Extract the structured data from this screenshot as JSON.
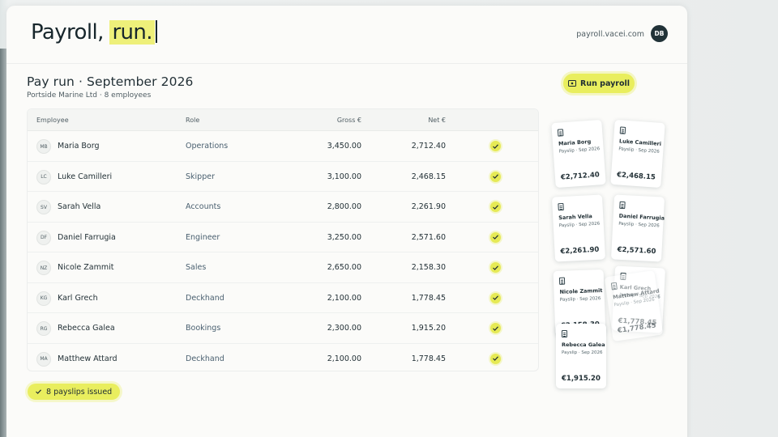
{
  "app": {
    "logo_main": "Payroll,",
    "logo_highlight": "run.",
    "domain": "payroll.vacei.com",
    "user_initials": "DB"
  },
  "header": {
    "title": "Pay run · September 2026",
    "subtitle": "Portside Marine Ltd · 8 employees",
    "run_button": "Run payroll"
  },
  "table": {
    "columns": [
      "Employee",
      "Role",
      "Gross €",
      "Net €"
    ],
    "rows": [
      {
        "initials": "MB",
        "name": "Maria Borg",
        "role": "Operations",
        "gross": "3,450.00",
        "net": "2,712.40"
      },
      {
        "initials": "LC",
        "name": "Luke Camilleri",
        "role": "Skipper",
        "gross": "3,100.00",
        "net": "2,468.15"
      },
      {
        "initials": "SV",
        "name": "Sarah Vella",
        "role": "Accounts",
        "gross": "2,800.00",
        "net": "2,261.90"
      },
      {
        "initials": "DF",
        "name": "Daniel Farrugia",
        "role": "Engineer",
        "gross": "3,250.00",
        "net": "2,571.60"
      },
      {
        "initials": "NZ",
        "name": "Nicole Zammit",
        "role": "Sales",
        "gross": "2,650.00",
        "net": "2,158.30"
      },
      {
        "initials": "KG",
        "name": "Karl Grech",
        "role": "Deckhand",
        "gross": "2,100.00",
        "net": "1,778.45"
      },
      {
        "initials": "RG",
        "name": "Rebecca Galea",
        "role": "Bookings",
        "gross": "2,300.00",
        "net": "1,915.20"
      },
      {
        "initials": "MA",
        "name": "Matthew Attard",
        "role": "Deckhand",
        "gross": "2,100.00",
        "net": "1,778.45"
      }
    ]
  },
  "footer": {
    "issued": "8 payslips issued"
  },
  "payslips": [
    {
      "name": "Maria Borg",
      "meta": "Payslip · Sep 2026",
      "amount": "€2,712.40"
    },
    {
      "name": "Luke Camilleri",
      "meta": "Payslip · Sep 2026",
      "amount": "€2,468.15"
    },
    {
      "name": "Sarah Vella",
      "meta": "Payslip · Sep 2026",
      "amount": "€2,261.90"
    },
    {
      "name": "Daniel Farrugia",
      "meta": "Payslip · Sep 2026",
      "amount": "€2,571.60"
    },
    {
      "name": "Nicole Zammit",
      "meta": "Payslip · Sep 2026",
      "amount": "€2,158.30"
    },
    {
      "name": "Karl Grech",
      "meta": "Payslip · Sep 2026",
      "amount": "€1,778.45"
    },
    {
      "name": "Matthew Attard",
      "meta": "Payslip · Sep 2026",
      "amount": "€1,778.45"
    },
    {
      "name": "Rebecca Galea",
      "meta": "Payslip · Sep 2026",
      "amount": "€1,915.20"
    }
  ],
  "colors": {
    "accent": "#e9ee5e",
    "text": "#1f2d33",
    "muted": "#4f5d63"
  }
}
